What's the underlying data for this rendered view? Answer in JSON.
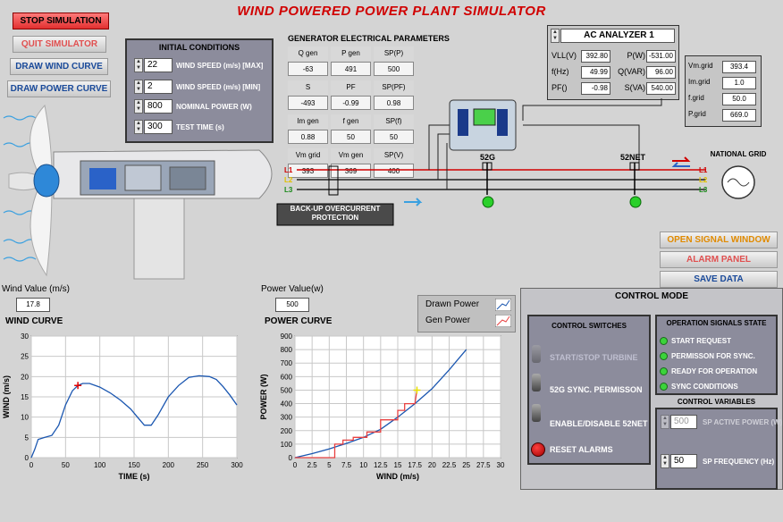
{
  "app_title": "WIND POWERED POWER PLANT SIMULATOR",
  "buttons": {
    "stop": "STOP SIMULATION",
    "quit": "QUIT SIMULATOR",
    "draw_wind": "DRAW WIND CURVE",
    "draw_power": "DRAW POWER CURVE",
    "open_signal": "OPEN SIGNAL WINDOW",
    "alarm": "ALARM PANEL",
    "save": "SAVE DATA"
  },
  "initial_conditions": {
    "title": "INITIAL CONDITIONS",
    "rows": [
      {
        "value": "22",
        "label": "WIND SPEED  (m/s) [MAX]"
      },
      {
        "value": "2",
        "label": "WIND SPEED  (m/s) [MIN]"
      },
      {
        "value": "800",
        "label": "NOMINAL POWER  (W)"
      },
      {
        "value": "300",
        "label": "TEST TIME (s)"
      }
    ]
  },
  "generator": {
    "title": "GENERATOR ELECTRICAL PARAMETERS",
    "headers": [
      [
        "Q gen",
        "P gen",
        "SP(P)"
      ],
      [
        "S",
        "PF",
        "SP(PF)"
      ],
      [
        "Im gen",
        "f gen",
        "SP(f)"
      ],
      [
        "Vm grid",
        "Vm gen",
        "SP(V)"
      ]
    ],
    "values": [
      [
        "-63",
        "491",
        "500"
      ],
      [
        "-493",
        "-0.99",
        "0.98"
      ],
      [
        "0.88",
        "50",
        "50"
      ],
      [
        "393",
        "369",
        "400"
      ]
    ]
  },
  "ac_analyzer": {
    "title": "AC ANALYZER 1",
    "rows": [
      {
        "l1": "VLL(V)",
        "v1": "392.80",
        "l2": "P(W)",
        "v2": "-531.00"
      },
      {
        "l1": "f(Hz)",
        "v1": "49.99",
        "l2": "Q(VAR)",
        "v2": "96.00"
      },
      {
        "l1": "PF()",
        "v1": "-0.98",
        "l2": "S(VA)",
        "v2": "540.00"
      }
    ]
  },
  "grid_values": [
    {
      "label": "Vm.grid",
      "value": "393.4"
    },
    {
      "label": "Im.grid",
      "value": "1.0"
    },
    {
      "label": "f.grid",
      "value": "50.0"
    },
    {
      "label": "P.grid",
      "value": "669.0"
    }
  ],
  "diagram": {
    "breaker1": "52G",
    "breaker2": "52NET",
    "grid_label": "NATIONAL GRID",
    "protection": "BACK-UP OVERCURRENT PROTECTION",
    "phases": [
      "L1",
      "L2",
      "L3"
    ]
  },
  "readouts": {
    "wind_label": "Wind Value (m/s)",
    "wind_value": "17.8",
    "power_label": "Power Value(w)",
    "power_value": "500"
  },
  "legend": {
    "drawn": "Drawn Power",
    "gen": "Gen Power"
  },
  "control": {
    "title": "CONTROL MODE",
    "switches_title": "CONTROL SWITCHES",
    "switches": [
      "START/STOP TURBINE",
      "52G SYNC. PERMISSON",
      "ENABLE/DISABLE 52NET",
      "RESET ALARMS"
    ],
    "signals_title": "OPERATION SIGNALS STATE",
    "signals": [
      "START REQUEST",
      "PERMISSON FOR SYNC.",
      "READY FOR OPERATION",
      "SYNC CONDITIONS"
    ],
    "variables_title": "CONTROL VARIABLES",
    "sp_power_value": "500",
    "sp_power_label": "SP ACTIVE POWER (W)",
    "sp_freq_value": "50",
    "sp_freq_label": "SP FREQUENCY (Hz)"
  },
  "colors": {
    "title": "#d00000",
    "panel": "#8c8c9c",
    "led_on": "#3bd33b",
    "drawn_line": "#1a56b0",
    "gen_line": "#e84040"
  },
  "chart_data": [
    {
      "type": "line",
      "title": "WIND CURVE",
      "xlabel": "TIME (s)",
      "ylabel": "WIND (m/s)",
      "xlim": [
        0,
        300
      ],
      "ylim": [
        0,
        30
      ],
      "xticks": [
        0,
        50,
        100,
        150,
        200,
        250,
        300
      ],
      "yticks": [
        0,
        5,
        10,
        15,
        20,
        25,
        30
      ],
      "series": [
        {
          "x": [
            0,
            5,
            10,
            20,
            30,
            40,
            50,
            60,
            68,
            75,
            85,
            100,
            115,
            130,
            145,
            155,
            165,
            175,
            185,
            200,
            215,
            230,
            245,
            260,
            270,
            280,
            290,
            300
          ],
          "y": [
            0,
            2,
            4.5,
            5,
            5.5,
            8,
            13,
            16.5,
            17.8,
            18.3,
            18.3,
            17.4,
            16,
            14.2,
            12,
            10,
            8,
            8,
            10.5,
            15,
            17.8,
            19.8,
            20.2,
            20,
            19.3,
            17.5,
            15.4,
            13
          ]
        }
      ],
      "marker": {
        "x": 68,
        "y": 17.8
      }
    },
    {
      "type": "line",
      "title": "POWER CURVE",
      "xlabel": "WIND (m/s)",
      "ylabel": "POWER (W)",
      "xlim": [
        0,
        30
      ],
      "ylim": [
        0,
        900
      ],
      "xticks": [
        0,
        2.5,
        5,
        7.5,
        10,
        12.5,
        15,
        17.5,
        20,
        22.5,
        25,
        27.5,
        30
      ],
      "yticks": [
        0,
        100,
        200,
        300,
        400,
        500,
        600,
        700,
        800,
        900
      ],
      "series": [
        {
          "name": "Drawn Power",
          "x": [
            0,
            2.5,
            5,
            7.5,
            10,
            12.5,
            15,
            17.5,
            20,
            22.5,
            25
          ],
          "y": [
            0,
            30,
            65,
            105,
            150,
            210,
            300,
            400,
            510,
            650,
            800
          ]
        },
        {
          "name": "Gen Power",
          "x": [
            0,
            5.8,
            5.8,
            7,
            7,
            8.5,
            8.5,
            10.5,
            10.5,
            12.5,
            12.5,
            15,
            15,
            16,
            16,
            17.5,
            17.8
          ],
          "y": [
            0,
            0,
            100,
            100,
            130,
            130,
            150,
            150,
            190,
            190,
            280,
            280,
            350,
            350,
            400,
            400,
            500
          ]
        }
      ],
      "marker": {
        "x": 17.8,
        "y": 500
      }
    }
  ]
}
